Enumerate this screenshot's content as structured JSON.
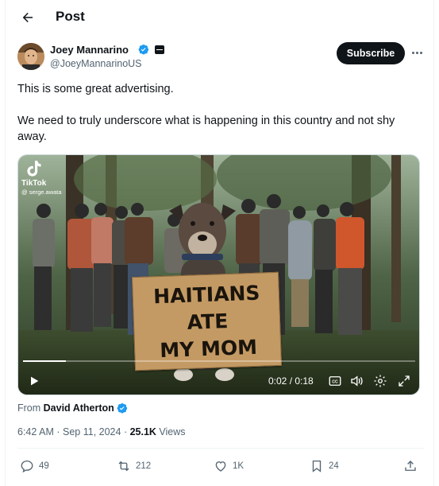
{
  "header": {
    "title": "Post",
    "back_icon": "arrow-left-icon"
  },
  "author": {
    "name": "Joey Mannarino",
    "handle": "@JoeyMannarinoUS",
    "verified_color": "#1d9bf0",
    "subscribe_label": "Subscribe"
  },
  "tweet": {
    "lines": [
      "This is some great advertising.",
      "We need to truly underscore what is happening in this country and not shy away."
    ]
  },
  "video": {
    "watermark_app": "TikTok",
    "watermark_user": "@ serge.awata",
    "sign_lines": [
      "HAITIANS",
      "ATE",
      "MY MOM"
    ],
    "time_current": "0:02",
    "time_total": "0:18",
    "time_display": "0:02 / 0:18",
    "progress": 0.11
  },
  "attribution": {
    "prefix": "From",
    "name": "David Atherton"
  },
  "meta": {
    "time": "6:42 AM",
    "date": "Sep 11, 2024",
    "views_count": "25.1K",
    "views_label": "Views"
  },
  "actions": {
    "replies": "49",
    "reposts": "212",
    "likes": "1K",
    "bookmarks": "24"
  },
  "colors": {
    "accent": "#1d9bf0",
    "text": "#0f1419",
    "muted": "#536471"
  }
}
